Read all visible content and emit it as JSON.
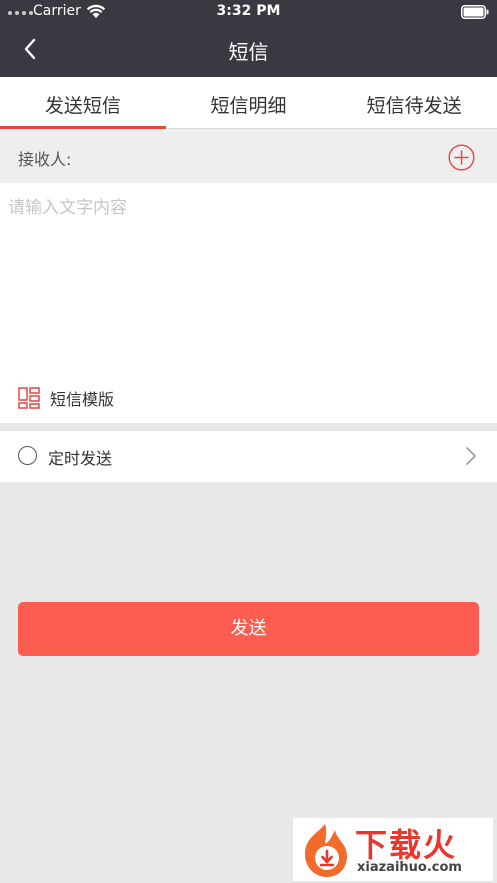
{
  "status_bar": {
    "carrier": "Carrier",
    "time": "3:32 PM"
  },
  "nav": {
    "title": "短信",
    "back_icon": "chevron-left-icon"
  },
  "tabs": [
    {
      "label": "发送短信",
      "active": true
    },
    {
      "label": "短信明细",
      "active": false
    },
    {
      "label": "短信待发送",
      "active": false
    }
  ],
  "recipient": {
    "label": "接收人:",
    "add_icon": "plus-circle-icon"
  },
  "message": {
    "value": "",
    "placeholder": "请输入文字内容"
  },
  "template": {
    "label": "短信模版",
    "icon": "template-icon"
  },
  "schedule": {
    "label": "定时发送",
    "checked": false
  },
  "send_button": {
    "label": "发送"
  },
  "watermark": {
    "cn": "下载火",
    "en": "xiazaihuo.com"
  },
  "colors": {
    "accent": "#e9453f",
    "send_button": "#fd5c50",
    "nav_bg": "#3a3840",
    "page_bg": "#e8e8e8"
  }
}
